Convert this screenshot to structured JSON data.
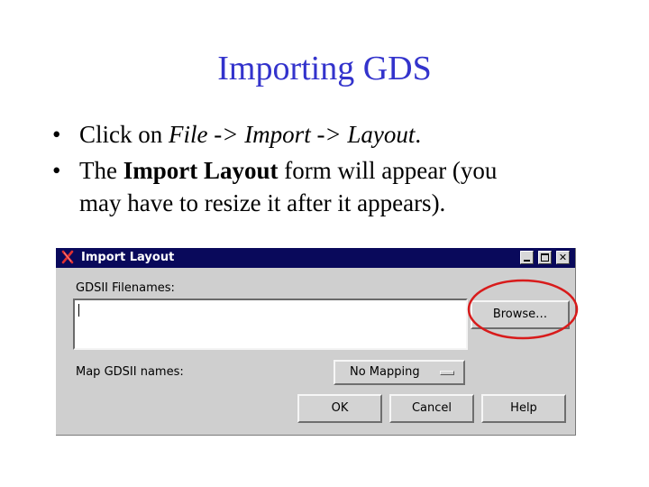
{
  "slide": {
    "title": "Importing GDS",
    "bullets": [
      {
        "bullet": "•",
        "prefix": "Click on ",
        "italic": "File -> Import -> Layout",
        "suffix": "."
      },
      {
        "bullet": "•",
        "prefix": "The ",
        "bold": "Import Layout",
        "suffix": " form will appear (you",
        "line2": "may have to resize it after it appears)."
      }
    ]
  },
  "dialog": {
    "title": "Import Layout",
    "logo_icon": "x-logo-icon",
    "window_controls": {
      "minimize_icon": "minimize-icon",
      "maximize_icon": "maximize-icon",
      "close_glyph": "✕"
    },
    "filenames_label": "GDSII Filenames:",
    "filenames_value": "",
    "browse_label": "Browse…",
    "map_label": "Map GDSII names:",
    "map_value": "No Mapping",
    "ok_label": "OK",
    "cancel_label": "Cancel",
    "help_label": "Help"
  },
  "colors": {
    "title_text": "#3333cc",
    "titlebar": "#09095b",
    "dialog_bg": "#cfcfcf",
    "highlight": "#d81b1b"
  }
}
